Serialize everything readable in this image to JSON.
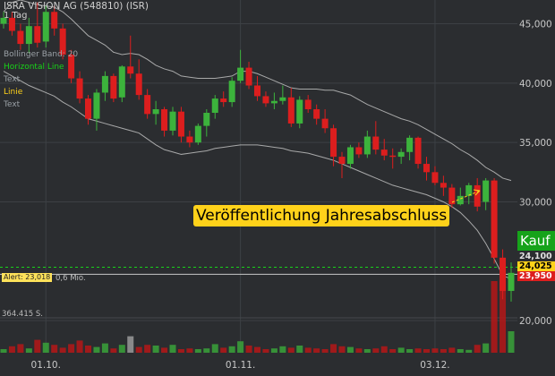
{
  "header": {
    "title": "ISRA VISION AG (548810) (ISR)",
    "interval": "1 Tag"
  },
  "legend": [
    {
      "label": "Bollinger Band: 20",
      "color": "#9aa0a6"
    },
    {
      "label": "Horizontal Line",
      "color": "#19d219"
    },
    {
      "label": "Text",
      "color": "#9aa0a6"
    },
    {
      "label": "Linie",
      "color": "#ffd21a"
    },
    {
      "label": "Text",
      "color": "#9aa0a6"
    }
  ],
  "annotation": "Veröffentlichung Jahresabschluss",
  "buy_button": "Kauf",
  "price_tags": {
    "ask": "24,100",
    "last": "24,025",
    "bid": "23,950"
  },
  "alert_label": "Alert: 23,018",
  "volume_axis_label": "0,6 Mio.",
  "volume_max_label": "364.415 S.",
  "colors": {
    "up": "#3cb33c",
    "down": "#dc1e1e",
    "background": "#2b2d30",
    "band": "#c8c8c8",
    "hline": "#19d219",
    "gold": "#ffd21a"
  },
  "chart_data": {
    "type": "candlestick",
    "y_ticks": [
      "45,000",
      "40,000",
      "35,000",
      "30,000",
      "20,000"
    ],
    "y_tick_values": [
      45,
      40,
      35,
      30,
      20
    ],
    "x_ticks": [
      "01.10.",
      "01.11.",
      "03.12."
    ],
    "x_tick_positions": [
      5,
      28,
      51
    ],
    "ylim": [
      18.2,
      47.0
    ],
    "hline": 24.5,
    "alert_level": 23.9,
    "candles": [
      [
        45,
        46,
        44.6,
        45.5
      ],
      [
        45.5,
        46,
        44,
        44.4
      ],
      [
        44.4,
        45,
        42.8,
        43.3
      ],
      [
        43.3,
        45.5,
        42.5,
        44.8
      ],
      [
        44.8,
        46.8,
        43,
        43.4
      ],
      [
        43.5,
        46.5,
        43,
        46
      ],
      [
        46,
        46.5,
        44,
        44.6
      ],
      [
        44.6,
        45,
        42,
        42.4
      ],
      [
        42.4,
        42.8,
        40,
        40.4
      ],
      [
        40.4,
        41,
        38.3,
        38.7
      ],
      [
        38.7,
        39,
        36.5,
        37
      ],
      [
        37,
        39.5,
        36,
        39.2
      ],
      [
        39.2,
        41,
        38.5,
        40.6
      ],
      [
        40.6,
        40.8,
        38.4,
        38.7
      ],
      [
        38.8,
        41.5,
        38.4,
        41.4
      ],
      [
        41.4,
        44,
        40.4,
        40.8
      ],
      [
        40.8,
        42,
        38.6,
        39
      ],
      [
        39,
        39.5,
        37,
        37.4
      ],
      [
        37.4,
        38.5,
        36.5,
        37.8
      ],
      [
        37.8,
        38,
        35.5,
        36
      ],
      [
        36,
        38,
        35.6,
        37.6
      ],
      [
        37.6,
        38,
        35,
        35.5
      ],
      [
        35.5,
        36,
        34.6,
        35
      ],
      [
        35,
        36.6,
        34.8,
        36.4
      ],
      [
        36.4,
        37.8,
        35.5,
        37.5
      ],
      [
        37.5,
        39,
        37,
        38.7
      ],
      [
        38.7,
        39.3,
        38,
        38.4
      ],
      [
        38.4,
        40.5,
        38,
        40.2
      ],
      [
        40.2,
        42.8,
        40,
        41.3
      ],
      [
        41.3,
        41.8,
        39.5,
        39.8
      ],
      [
        39.8,
        40.6,
        38.5,
        38.9
      ],
      [
        38.9,
        39.3,
        38,
        38.3
      ],
      [
        38.3,
        39.2,
        37.8,
        38.5
      ],
      [
        38.5,
        39.8,
        38.2,
        38.8
      ],
      [
        38.8,
        39.6,
        36.3,
        36.6
      ],
      [
        36.6,
        38.9,
        36.2,
        38.6
      ],
      [
        38.6,
        39,
        37.5,
        37.8
      ],
      [
        37.8,
        38.2,
        36.5,
        37
      ],
      [
        37,
        37.8,
        35.8,
        36.2
      ],
      [
        36.2,
        36.5,
        33,
        33.8
      ],
      [
        33.8,
        34.2,
        32,
        33.2
      ],
      [
        33.2,
        34.8,
        32.8,
        34.6
      ],
      [
        34.6,
        35,
        33.7,
        34
      ],
      [
        34,
        36,
        33.7,
        35.5
      ],
      [
        35.5,
        36.8,
        34,
        34.4
      ],
      [
        34.4,
        35.3,
        33.5,
        33.9
      ],
      [
        33.9,
        34.5,
        32.8,
        33.8
      ],
      [
        33.8,
        34.5,
        33.2,
        34.2
      ],
      [
        34.2,
        35.6,
        33.5,
        35.4
      ],
      [
        35.4,
        35.5,
        32.8,
        33.2
      ],
      [
        33.2,
        33.8,
        31.8,
        32.5
      ],
      [
        32.5,
        33,
        31.4,
        31.6
      ],
      [
        31.6,
        32.2,
        30.5,
        31.2
      ],
      [
        31.2,
        31.5,
        29.5,
        29.8
      ],
      [
        29.8,
        31.2,
        29.7,
        30.5
      ],
      [
        30.5,
        31.6,
        29.8,
        31.4
      ],
      [
        31.4,
        32,
        29.2,
        29.6
      ],
      [
        30,
        32,
        29.3,
        31.8
      ],
      [
        31.8,
        32,
        24.8,
        25.3
      ],
      [
        25.3,
        26,
        21.8,
        22.5
      ],
      [
        22.5,
        24.9,
        21.6,
        24.02
      ]
    ],
    "band_upper": [
      46,
      46.8,
      47,
      46.8,
      46.6,
      46.5,
      46.4,
      46,
      45.4,
      44.7,
      44,
      43.6,
      43.2,
      42.6,
      42.4,
      42.5,
      42.4,
      42,
      41.5,
      41.2,
      41,
      40.6,
      40.5,
      40.4,
      40.4,
      40.4,
      40.5,
      40.6,
      41,
      41,
      40.8,
      40.5,
      40.2,
      39.9,
      39.6,
      39.5,
      39.5,
      39.5,
      39.4,
      39.4,
      39.2,
      39,
      38.6,
      38.2,
      37.9,
      37.6,
      37.3,
      37,
      36.8,
      36.5,
      36.1,
      35.7,
      35.3,
      34.9,
      34.4,
      34,
      33.5,
      32.9,
      32.5,
      32,
      31.8
    ],
    "band_lower": [
      41,
      40.6,
      40.2,
      39.8,
      39.5,
      39.2,
      38.9,
      38.4,
      38,
      37.5,
      37,
      36.8,
      36.6,
      36.4,
      36.2,
      36,
      35.8,
      35.3,
      34.8,
      34.4,
      34.2,
      34,
      34.1,
      34.2,
      34.3,
      34.5,
      34.6,
      34.7,
      34.8,
      34.8,
      34.8,
      34.7,
      34.6,
      34.5,
      34.3,
      34.2,
      34.1,
      33.9,
      33.7,
      33.5,
      33.2,
      32.9,
      32.6,
      32.3,
      32,
      31.7,
      31.4,
      31.2,
      31,
      30.8,
      30.6,
      30.3,
      30,
      29.6,
      29.1,
      28.4,
      27.6,
      26.5,
      25.2,
      23.8,
      23.5
    ],
    "volumes": [
      0.05,
      0.09,
      0.12,
      0.06,
      0.18,
      0.14,
      0.11,
      0.07,
      0.12,
      0.17,
      0.1,
      0.08,
      0.13,
      0.06,
      0.11,
      0.23,
      0.08,
      0.11,
      0.1,
      0.07,
      0.11,
      0.05,
      0.06,
      0.05,
      0.06,
      0.12,
      0.07,
      0.09,
      0.16,
      0.1,
      0.08,
      0.05,
      0.06,
      0.09,
      0.07,
      0.1,
      0.07,
      0.06,
      0.05,
      0.12,
      0.09,
      0.08,
      0.06,
      0.05,
      0.06,
      0.09,
      0.05,
      0.07,
      0.05,
      0.06,
      0.05,
      0.06,
      0.05,
      0.07,
      0.05,
      0.04,
      0.11,
      0.13,
      1.0,
      1.0,
      0.3
    ]
  }
}
